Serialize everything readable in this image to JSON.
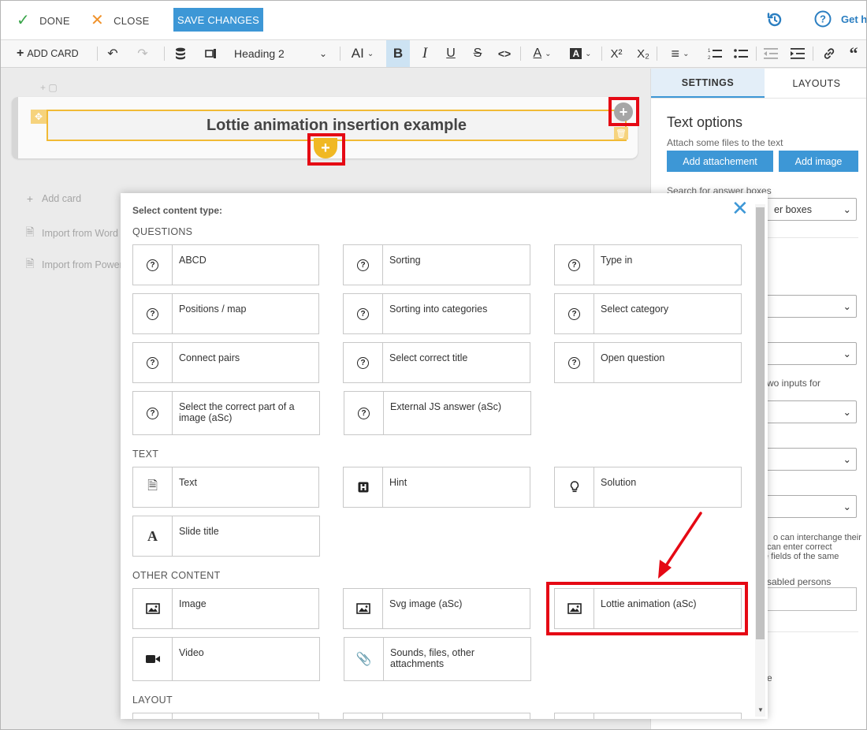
{
  "topbar": {
    "done_label": "DONE",
    "close_label": "CLOSE",
    "save_label": "SAVE CHANGES",
    "help_label": "Get he"
  },
  "toolbar": {
    "add_card_label": "ADD CARD",
    "heading_value": "Heading 2",
    "superscript": "X²",
    "subscript": "X₂"
  },
  "canvas": {
    "card_title": "Lottie animation insertion example",
    "add_card": "Add card",
    "import_word": "Import from Word",
    "import_power": "Import from Power"
  },
  "panel": {
    "tab_settings": "SETTINGS",
    "tab_layouts": "LAYOUTS",
    "title": "Text options",
    "attach_text": "Attach some files to the text",
    "add_attachment": "Add attachement",
    "add_image": "Add image",
    "search_label": "Search for answer boxes",
    "select_value": "er boxes",
    "frag_inputs": "wo inputs for",
    "frag_line1": "o can interchange their",
    "frag_line2": "can enter correct",
    "frag_line3": "e fields of the same",
    "frag_disabled": "sabled persons",
    "frag_e": "e"
  },
  "dialog": {
    "title": "Select content type:",
    "sections": {
      "questions": "QUESTIONS",
      "text": "TEXT",
      "other": "OTHER CONTENT",
      "layout": "LAYOUT"
    },
    "questions": [
      "ABCD",
      "Sorting",
      "Type in",
      "Positions / map",
      "Sorting into categories",
      "Select category",
      "Connect pairs",
      "Select correct title",
      "Open question",
      "Select the correct part of a image (aSc)",
      "External JS answer (aSc)"
    ],
    "text_items": [
      "Text",
      "Hint",
      "Solution",
      "Slide title"
    ],
    "other_items": [
      "Image",
      "Svg image (aSc)",
      "Lottie animation (aSc)",
      "Video",
      "Sounds, files, other attachments"
    ]
  },
  "colors": {
    "accent": "#3d97d6",
    "highlight": "#e50914",
    "card_border": "#f1ba35",
    "yellow_plus": "#f0b823"
  }
}
